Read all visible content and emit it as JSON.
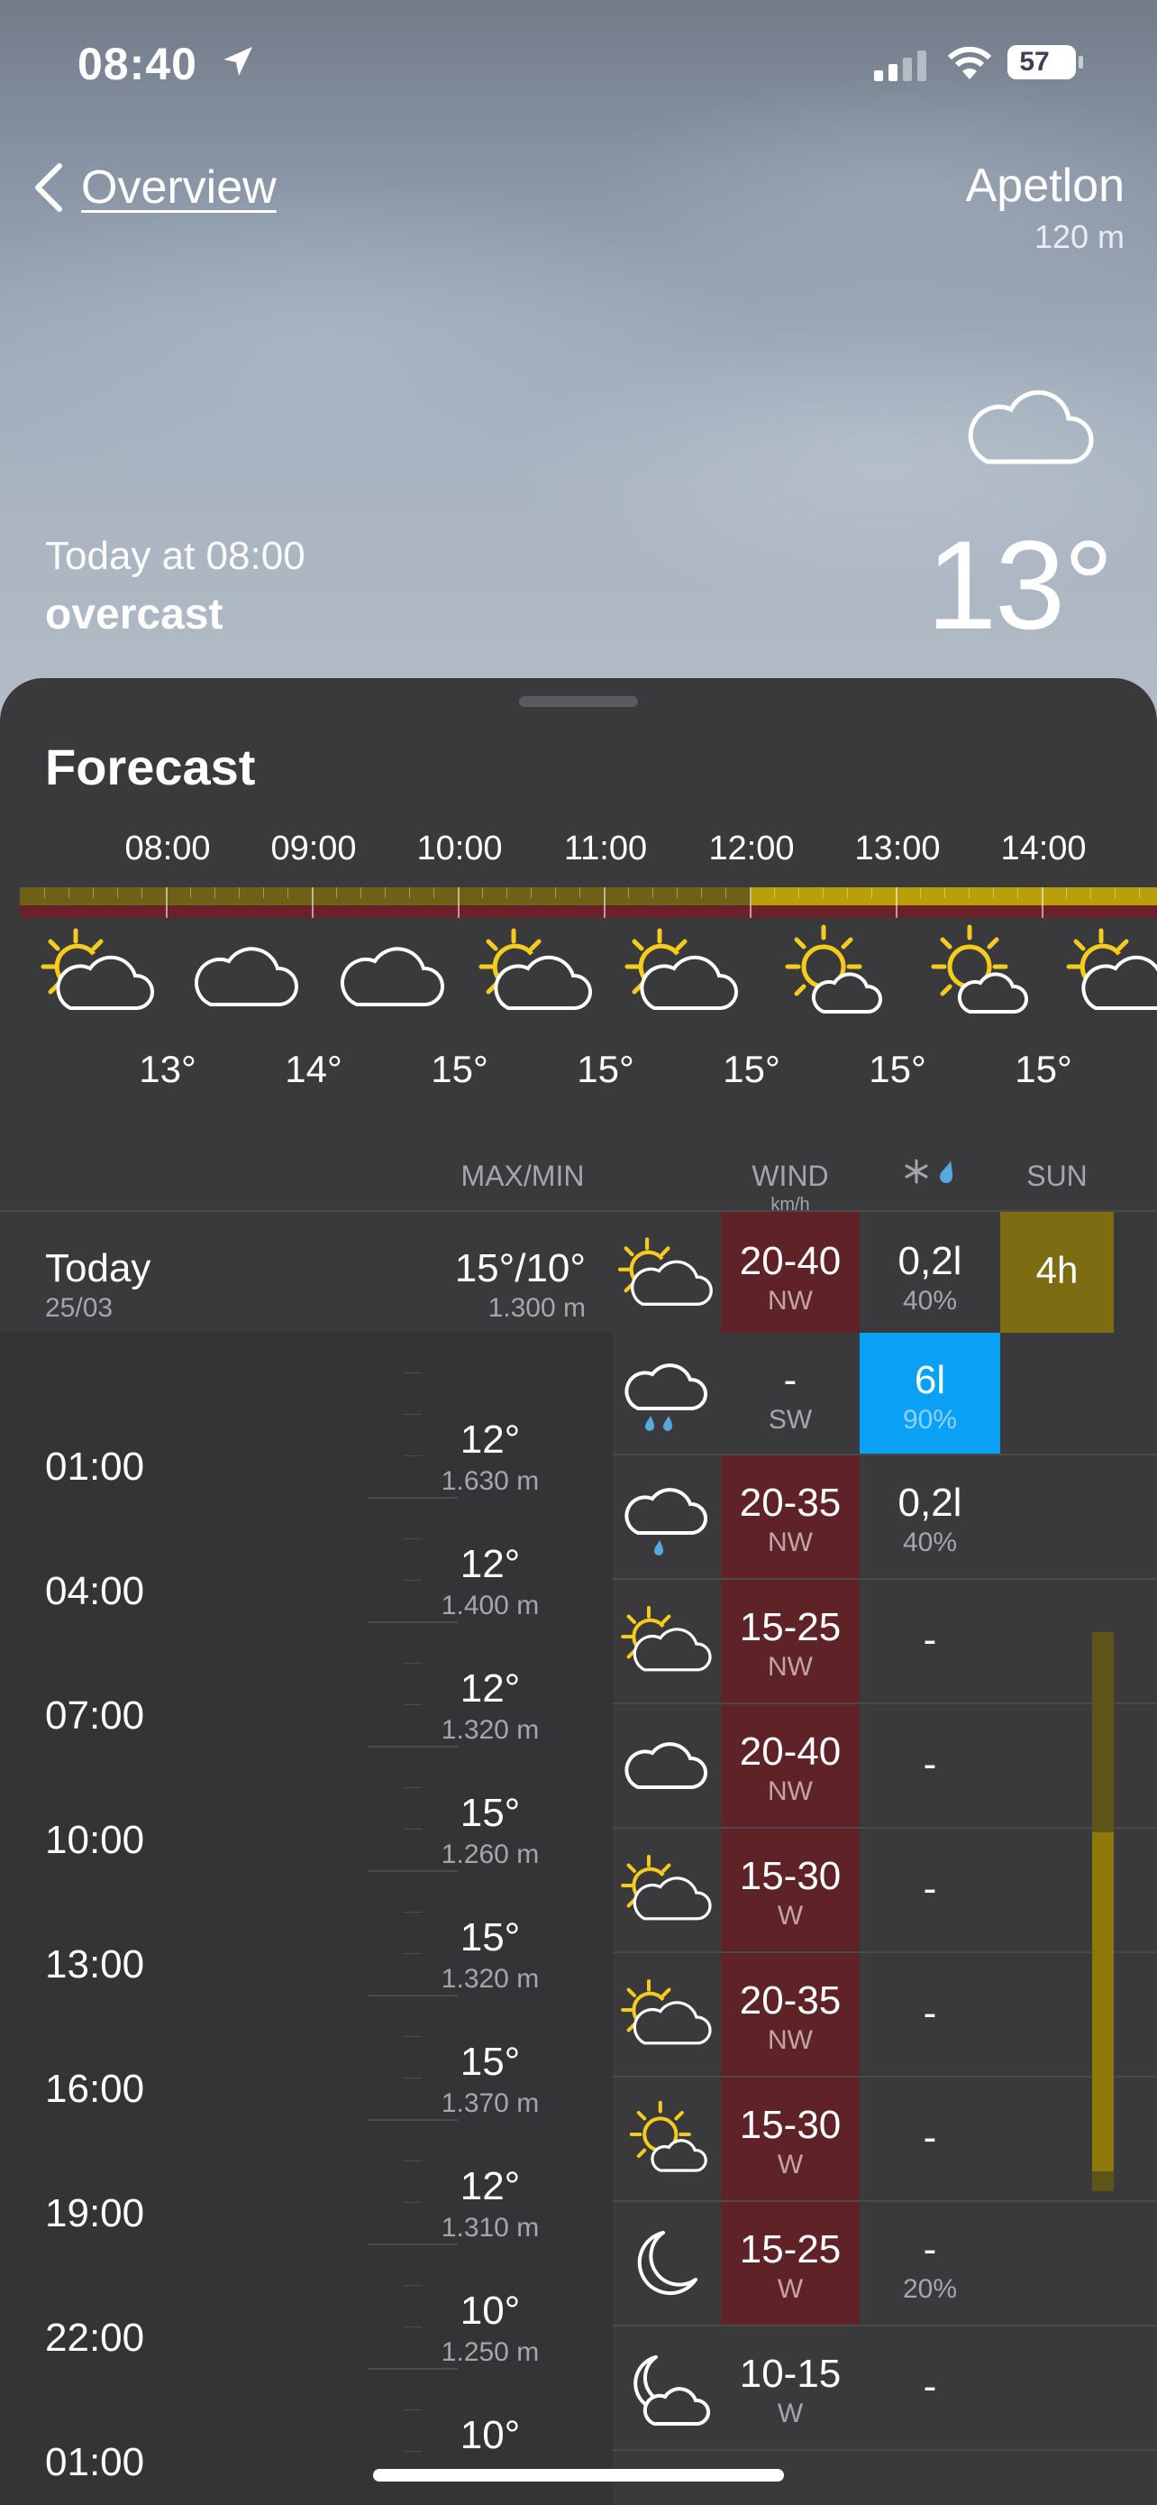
{
  "status_bar": {
    "time": "08:40",
    "battery": "57"
  },
  "nav": {
    "back_label": "Overview"
  },
  "location": {
    "name": "Apetlon",
    "altitude": "120 m"
  },
  "current": {
    "time_label": "Today at 08:00",
    "condition": "overcast",
    "temperature": "13°"
  },
  "forecast": {
    "title": "Forecast",
    "hours": [
      "08:00",
      "09:00",
      "10:00",
      "11:00",
      "12:00",
      "13:00",
      "14:00"
    ],
    "hour_icons": [
      "partly-cloudy-icon",
      "cloud-icon",
      "cloud-icon",
      "partly-cloudy-icon",
      "partly-cloudy-icon",
      "sun-cloud-icon",
      "sun-cloud-icon",
      "partly-cloudy-icon"
    ],
    "temps": [
      "13°",
      "14°",
      "15°",
      "15°",
      "15°",
      "15°",
      "15°"
    ]
  },
  "table": {
    "headers": {
      "maxmin": "MAX/MIN",
      "wind": "WIND",
      "wind_unit": "km/h",
      "sun": "SUN"
    },
    "today": {
      "day": "Today",
      "date": "25/03",
      "maxmin": "15°/10°",
      "freezing": "1.300 m",
      "wind": "20-40",
      "wind_dir": "NW",
      "precip": "0,2l",
      "precip_prob": "40%",
      "sun": "4h"
    },
    "hour_labels": [
      "01:00",
      "04:00",
      "07:00",
      "10:00",
      "13:00",
      "16:00",
      "19:00",
      "22:00",
      "01:00"
    ],
    "rows": [
      {
        "temp": "",
        "freezing": "",
        "icon": "rain-cloud-icon",
        "wind": "-",
        "wind_dir": "SW",
        "precip": "6l",
        "precip_prob": "90%"
      },
      {
        "temp": "12°",
        "freezing": "1.630 m",
        "icon": "drizzle-cloud-icon",
        "wind": "20-35",
        "wind_dir": "NW",
        "precip": "0,2l",
        "precip_prob": "40%"
      },
      {
        "temp": "12°",
        "freezing": "1.400 m",
        "icon": "partly-cloudy-icon",
        "wind": "15-25",
        "wind_dir": "NW",
        "precip": "-",
        "precip_prob": ""
      },
      {
        "temp": "12°",
        "freezing": "1.320 m",
        "icon": "cloud-icon",
        "wind": "20-40",
        "wind_dir": "NW",
        "precip": "-",
        "precip_prob": ""
      },
      {
        "temp": "15°",
        "freezing": "1.260 m",
        "icon": "partly-cloudy-icon",
        "wind": "15-30",
        "wind_dir": "W",
        "precip": "-",
        "precip_prob": ""
      },
      {
        "temp": "15°",
        "freezing": "1.320 m",
        "icon": "partly-cloudy-icon",
        "wind": "20-35",
        "wind_dir": "NW",
        "precip": "-",
        "precip_prob": ""
      },
      {
        "temp": "15°",
        "freezing": "1.370 m",
        "icon": "sun-cloud-icon",
        "wind": "15-30",
        "wind_dir": "W",
        "precip": "-",
        "precip_prob": ""
      },
      {
        "temp": "12°",
        "freezing": "1.310 m",
        "icon": "moon-icon",
        "wind": "15-25",
        "wind_dir": "W",
        "precip": "-",
        "precip_prob": "20%"
      },
      {
        "temp": "10°",
        "freezing": "1.250 m",
        "icon": "moon-cloud-icon",
        "wind": "10-15",
        "wind_dir": "W",
        "precip": "-",
        "precip_prob": ""
      },
      {
        "temp": "10°",
        "freezing": "",
        "icon": "",
        "wind": "",
        "wind_dir": "",
        "precip": "",
        "precip_prob": ""
      }
    ]
  },
  "colors": {
    "wind_bg": "#5e2227",
    "precip_bg": "#0aa0f5",
    "sun_bg": "#7d6c12",
    "sheet_bg": "#3a3a3d"
  }
}
